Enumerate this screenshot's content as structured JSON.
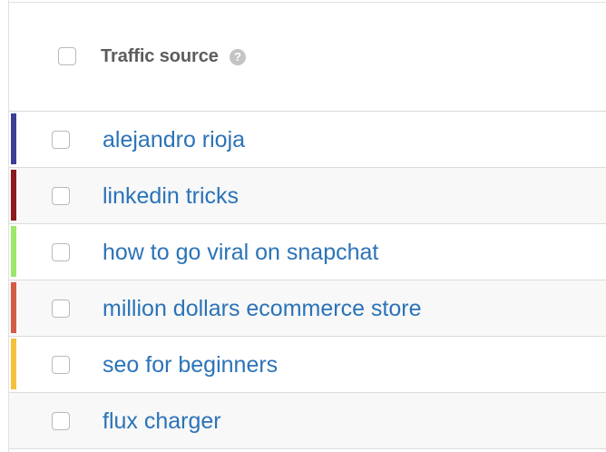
{
  "header": {
    "label": "Traffic source",
    "help_icon": "question-circle-icon"
  },
  "rows": [
    {
      "label": "alejandro rioja",
      "color": "#3d3d98"
    },
    {
      "label": "linkedin tricks",
      "color": "#8b1a1f"
    },
    {
      "label": "how to go viral on snapchat",
      "color": "#9be86a"
    },
    {
      "label": "million dollars ecommerce store",
      "color": "#d55a46"
    },
    {
      "label": "seo for beginners",
      "color": "#f5c03c"
    },
    {
      "label": "flux charger",
      "color": ""
    }
  ]
}
